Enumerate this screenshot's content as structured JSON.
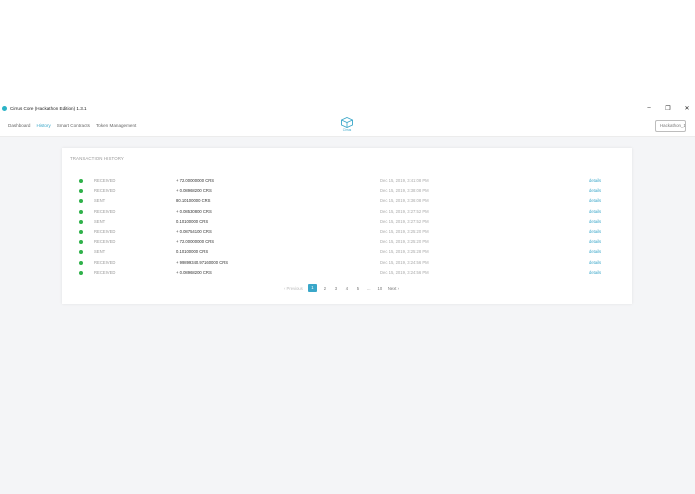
{
  "window": {
    "title": "Cirrus Core (Hackathon Edition) 1.3.1",
    "controls": {
      "minimize": "–",
      "maximize": "❐",
      "close": "✕"
    }
  },
  "nav": {
    "links": [
      "Dashboard",
      "History",
      "Smart Contracts",
      "Token Management"
    ],
    "active": "History",
    "logo_text": "Cirrus",
    "wallet_button": "Hackathon_1 ▾"
  },
  "history": {
    "title": "TRANSACTION HISTORY",
    "rows": [
      {
        "type": "RECEIVED",
        "amount": "+ 72.00000000 CRS",
        "date": "Dec 15, 2019, 3:41:08 PM",
        "details": "details"
      },
      {
        "type": "RECEIVED",
        "amount": "+ 0.08968200 CRS",
        "date": "Dec 15, 2019, 3:38:08 PM",
        "details": "details"
      },
      {
        "type": "SENT",
        "amount": "80.10100000 CRS",
        "date": "Dec 15, 2019, 3:36:08 PM",
        "details": "details"
      },
      {
        "type": "RECEIVED",
        "amount": "+ 0.08530800 CRS",
        "date": "Dec 15, 2019, 3:27:52 PM",
        "details": "details"
      },
      {
        "type": "SENT",
        "amount": "0.10100000 CRS",
        "date": "Dec 15, 2019, 3:27:52 PM",
        "details": "details"
      },
      {
        "type": "RECEIVED",
        "amount": "+ 0.08754100 CRS",
        "date": "Dec 15, 2019, 3:25:20 PM",
        "details": "details"
      },
      {
        "type": "RECEIVED",
        "amount": "+ 72.00000000 CRS",
        "date": "Dec 15, 2019, 3:25:20 PM",
        "details": "details"
      },
      {
        "type": "SENT",
        "amount": "0.10100000 CRS",
        "date": "Dec 15, 2019, 3:25:28 PM",
        "details": "details"
      },
      {
        "type": "RECEIVED",
        "amount": "+ 99899340.97160000 CRS",
        "date": "Dec 15, 2019, 3:24:56 PM",
        "details": "details"
      },
      {
        "type": "RECEIVED",
        "amount": "+ 0.08968200 CRS",
        "date": "Dec 15, 2019, 3:24:56 PM",
        "details": "details"
      }
    ],
    "pagination": {
      "previous": "‹ Previous",
      "pages": [
        "1",
        "2",
        "3",
        "4",
        "5",
        "...",
        "10"
      ],
      "current": "1",
      "next": "Next ›"
    }
  },
  "colors": {
    "accent": "#3aa7c9",
    "status_dot": "#2fb14a",
    "background": "#f4f5f7"
  }
}
